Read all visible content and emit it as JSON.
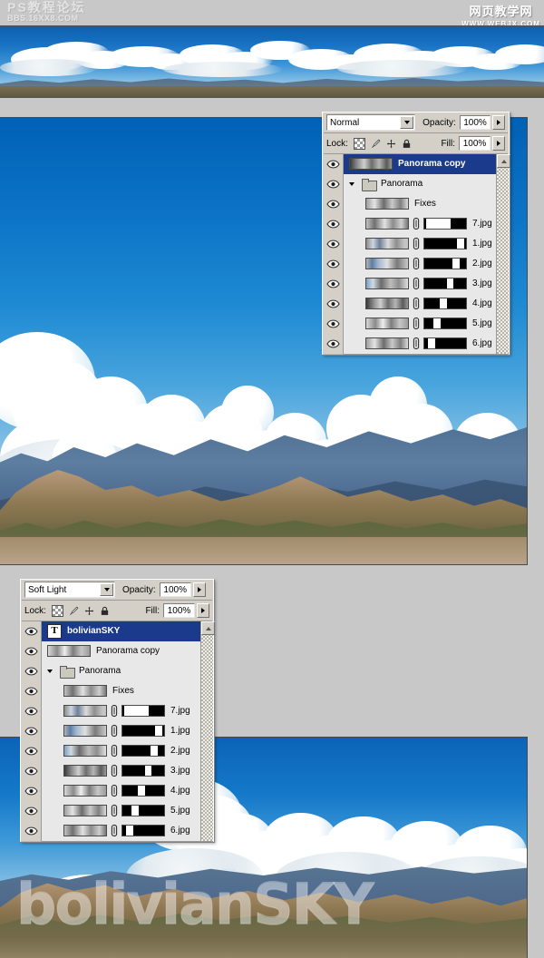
{
  "watermarks": {
    "top_left_line1": "PS教程论坛",
    "top_left_line2": "BBS.16XX8.COM",
    "top_right_line1": "网页教学网",
    "top_right_line2": "WWW.WEBJX.COM",
    "overlay_text": "bolivianSKY"
  },
  "panel1": {
    "blend_mode": "Normal",
    "opacity_label": "Opacity:",
    "opacity_value": "100%",
    "lock_label": "Lock:",
    "fill_label": "Fill:",
    "fill_value": "100%",
    "lock_icons": [
      "transparency-checker-icon",
      "brush-icon",
      "move-icon",
      "lock-icon"
    ],
    "layers": [
      {
        "name": "Panorama copy",
        "type": "image",
        "selected": true,
        "visible": true,
        "indent": 0,
        "has_mask": false,
        "has_link": false
      },
      {
        "name": "Panorama",
        "type": "group",
        "selected": false,
        "visible": true,
        "indent": 0,
        "has_mask": false,
        "has_link": false,
        "expanded": true
      },
      {
        "name": "Fixes",
        "type": "image",
        "selected": false,
        "visible": true,
        "indent": 1,
        "has_mask": false,
        "has_link": false
      },
      {
        "name": "7.jpg",
        "type": "image",
        "selected": false,
        "visible": true,
        "indent": 1,
        "has_mask": true,
        "has_link": true,
        "mask_white": [
          4,
          62
        ]
      },
      {
        "name": "1.jpg",
        "type": "image",
        "selected": false,
        "visible": true,
        "indent": 1,
        "has_mask": true,
        "has_link": true,
        "mask_white": [
          78,
          96
        ]
      },
      {
        "name": "2.jpg",
        "type": "image",
        "selected": false,
        "visible": true,
        "indent": 1,
        "has_mask": true,
        "has_link": true,
        "mask_white": [
          68,
          84
        ]
      },
      {
        "name": "3.jpg",
        "type": "image",
        "selected": false,
        "visible": true,
        "indent": 1,
        "has_mask": true,
        "has_link": true,
        "mask_white": [
          54,
          70
        ]
      },
      {
        "name": "4.jpg",
        "type": "image",
        "selected": false,
        "visible": true,
        "indent": 1,
        "has_mask": true,
        "has_link": true,
        "mask_white": [
          38,
          54
        ]
      },
      {
        "name": "5.jpg",
        "type": "image",
        "selected": false,
        "visible": true,
        "indent": 1,
        "has_mask": true,
        "has_link": true,
        "mask_white": [
          22,
          40
        ]
      },
      {
        "name": "6.jpg",
        "type": "image",
        "selected": false,
        "visible": true,
        "indent": 1,
        "has_mask": true,
        "has_link": true,
        "mask_white": [
          8,
          26
        ]
      }
    ]
  },
  "panel2": {
    "blend_mode": "Soft Light",
    "opacity_label": "Opacity:",
    "opacity_value": "100%",
    "lock_label": "Lock:",
    "fill_label": "Fill:",
    "fill_value": "100%",
    "lock_icons": [
      "transparency-checker-icon",
      "brush-icon",
      "move-icon",
      "lock-icon"
    ],
    "layers": [
      {
        "name": "bolivianSKY",
        "type": "text",
        "selected": true,
        "visible": true,
        "indent": 0,
        "has_mask": false,
        "has_link": false
      },
      {
        "name": "Panorama copy",
        "type": "image",
        "selected": false,
        "visible": true,
        "indent": 0,
        "has_mask": false,
        "has_link": false
      },
      {
        "name": "Panorama",
        "type": "group",
        "selected": false,
        "visible": true,
        "indent": 0,
        "has_mask": false,
        "has_link": false,
        "expanded": true
      },
      {
        "name": "Fixes",
        "type": "image",
        "selected": false,
        "visible": true,
        "indent": 1,
        "has_mask": false,
        "has_link": false
      },
      {
        "name": "7.jpg",
        "type": "image",
        "selected": false,
        "visible": true,
        "indent": 1,
        "has_mask": true,
        "has_link": true,
        "mask_white": [
          4,
          62
        ]
      },
      {
        "name": "1.jpg",
        "type": "image",
        "selected": false,
        "visible": true,
        "indent": 1,
        "has_mask": true,
        "has_link": true,
        "mask_white": [
          78,
          96
        ]
      },
      {
        "name": "2.jpg",
        "type": "image",
        "selected": false,
        "visible": true,
        "indent": 1,
        "has_mask": true,
        "has_link": true,
        "mask_white": [
          68,
          84
        ]
      },
      {
        "name": "3.jpg",
        "type": "image",
        "selected": false,
        "visible": true,
        "indent": 1,
        "has_mask": true,
        "has_link": true,
        "mask_white": [
          54,
          70
        ]
      },
      {
        "name": "4.jpg",
        "type": "image",
        "selected": false,
        "visible": true,
        "indent": 1,
        "has_mask": true,
        "has_link": true,
        "mask_white": [
          38,
          54
        ]
      },
      {
        "name": "5.jpg",
        "type": "image",
        "selected": false,
        "visible": true,
        "indent": 1,
        "has_mask": true,
        "has_link": true,
        "mask_white": [
          22,
          40
        ]
      },
      {
        "name": "6.jpg",
        "type": "image",
        "selected": false,
        "visible": true,
        "indent": 1,
        "has_mask": true,
        "has_link": true,
        "mask_white": [
          8,
          26
        ]
      }
    ]
  },
  "colors": {
    "panel_face": "#d4d0c8",
    "layer_list_bg": "#e8e8e8",
    "selection_blue": "#1b3a8b",
    "sky_blue": "#0c74c6",
    "rock_tan": "#b89a7e",
    "far_mountain": "#5a7596",
    "vegetation": "#4c6038"
  }
}
